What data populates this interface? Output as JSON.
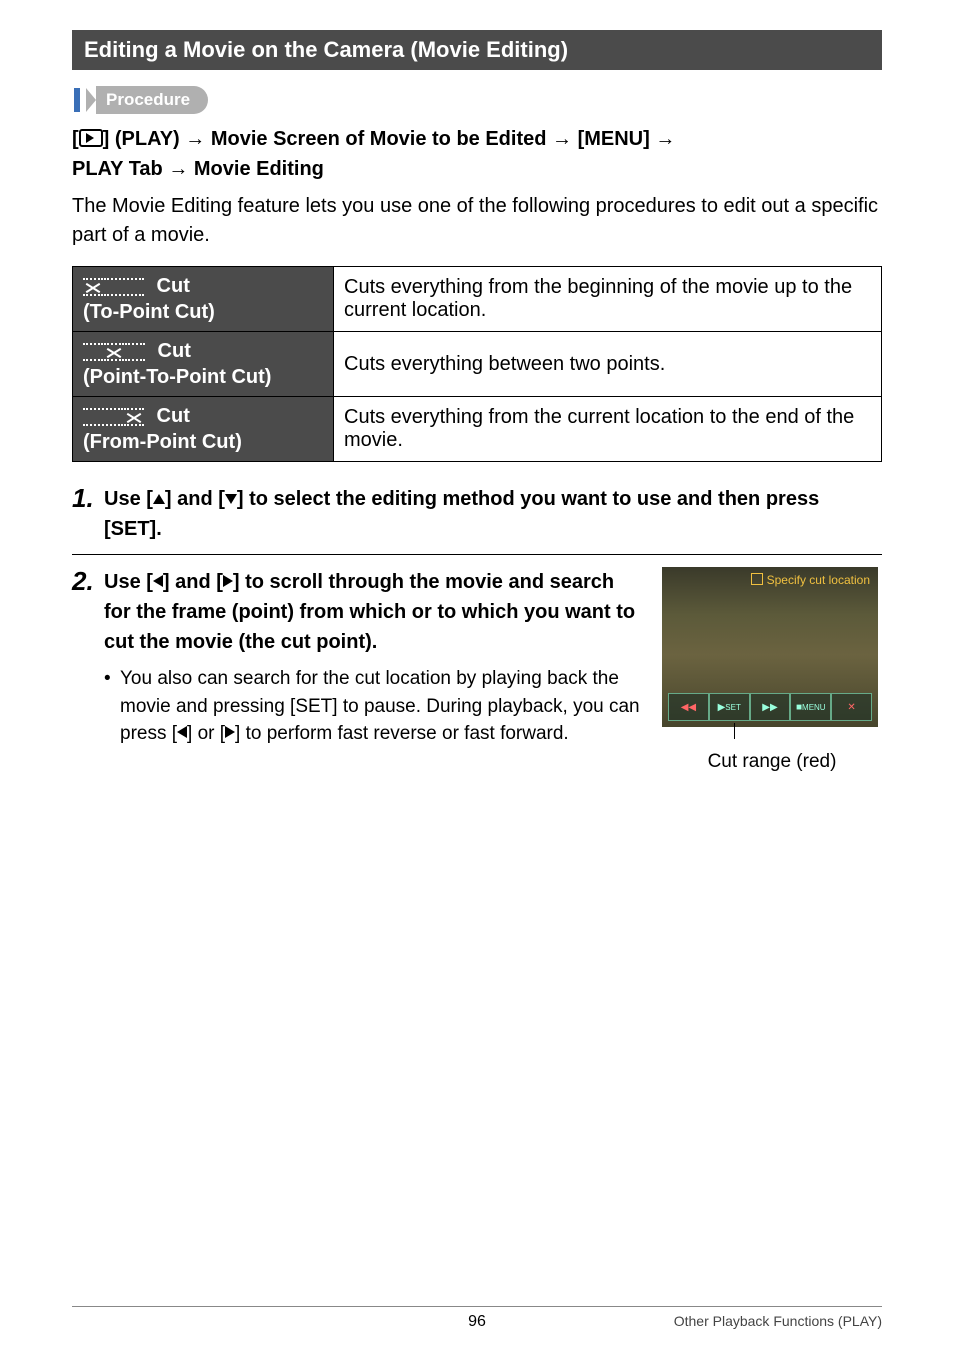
{
  "section_title": "Editing a Movie on the Camera (Movie Editing)",
  "procedure_label": "Procedure",
  "proc_path": {
    "p1a": "[",
    "p1b": "] (PLAY) ",
    "arrow": "→",
    "p2": " Movie Screen of Movie to be Edited ",
    "p3": " [MENU] ",
    "p4a": "PLAY Tab ",
    "p4b": " Movie Editing"
  },
  "intro": "The Movie Editing feature lets you use one of the following procedures to edit out a specific part of a movie.",
  "table": {
    "rows": [
      {
        "head_label": " Cut",
        "head_sub": "(To-Point Cut)",
        "pattern": "x--",
        "desc": "Cuts everything from the beginning of the movie up to the current location."
      },
      {
        "head_label": " Cut",
        "head_sub": "(Point-To-Point Cut)",
        "pattern": "-x-",
        "desc": "Cuts everything between two points."
      },
      {
        "head_label": " Cut",
        "head_sub": "(From-Point Cut)",
        "pattern": "--x",
        "desc": "Cuts everything from the current location to the end of the movie."
      }
    ]
  },
  "steps": {
    "s1": {
      "num": "1.",
      "text_a": "Use [",
      "text_b": "] and [",
      "text_c": "] to select the editing method you want to use and then press [SET]."
    },
    "s2": {
      "num": "2.",
      "text_a": "Use [",
      "text_b": "] and [",
      "text_c": "] to scroll through the movie and search for the frame (point) from which or to which you want to cut the movie (the cut point).",
      "bullet_a": "You also can search for the cut location by playing back the movie and pressing [SET] to pause. During playback, you can press [",
      "bullet_b": "] or [",
      "bullet_c": "] to perform fast reverse or fast forward."
    }
  },
  "image": {
    "top_label": "Specify cut location",
    "bar": [
      "◀◀",
      "▶",
      "▶▶",
      "■",
      "✕"
    ],
    "bar_side": [
      "◀",
      "SET",
      "▶",
      "MENU",
      ""
    ],
    "caption": "Cut range (red)"
  },
  "footer": {
    "page": "96",
    "title": "Other Playback Functions (PLAY)"
  }
}
